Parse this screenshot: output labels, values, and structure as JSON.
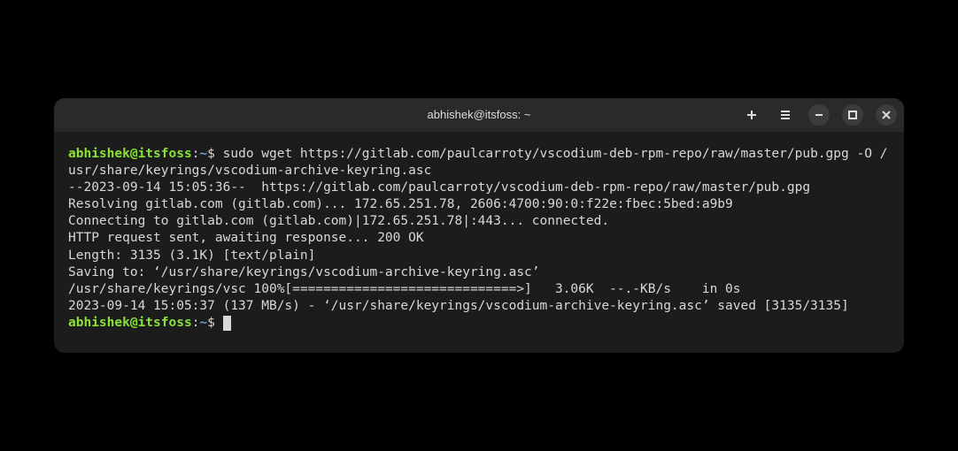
{
  "titlebar": {
    "title": "abhishek@itsfoss: ~"
  },
  "prompt": {
    "user_host": "abhishek@itsfoss",
    "colon": ":",
    "path": "~",
    "dollar": "$"
  },
  "command1": "sudo wget https://gitlab.com/paulcarroty/vscodium-deb-rpm-repo/raw/master/pub.gpg -O /usr/share/keyrings/vscodium-archive-keyring.asc",
  "output": {
    "l1": "--2023-09-14 15:05:36--  https://gitlab.com/paulcarroty/vscodium-deb-rpm-repo/raw/master/pub.gpg",
    "l2": "Resolving gitlab.com (gitlab.com)... 172.65.251.78, 2606:4700:90:0:f22e:fbec:5bed:a9b9",
    "l3": "Connecting to gitlab.com (gitlab.com)|172.65.251.78|:443... connected.",
    "l4": "HTTP request sent, awaiting response... 200 OK",
    "l5": "Length: 3135 (3.1K) [text/plain]",
    "l6": "Saving to: ‘/usr/share/keyrings/vscodium-archive-keyring.asc’",
    "blank1": "",
    "l7": "/usr/share/keyrings/vsc 100%[=============================>]   3.06K  --.-KB/s    in 0s",
    "blank2": "",
    "l8": "2023-09-14 15:05:37 (137 MB/s) - ‘/usr/share/keyrings/vscodium-archive-keyring.asc’ saved [3135/3135]",
    "blank3": ""
  }
}
